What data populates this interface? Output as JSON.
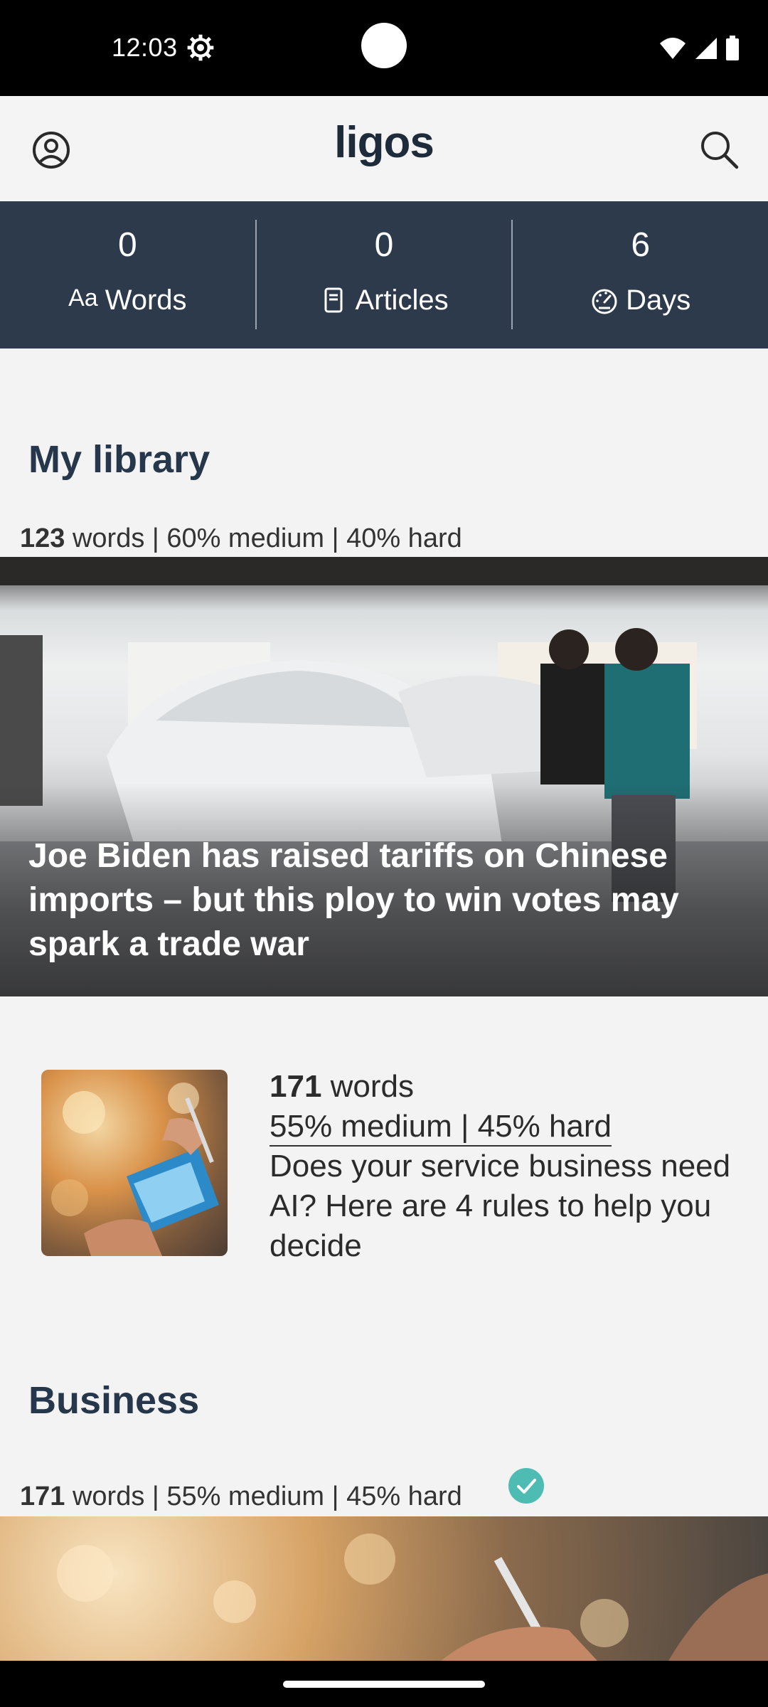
{
  "status_bar": {
    "time": "12:03"
  },
  "header": {
    "logo": "ligos"
  },
  "stats": [
    {
      "value": "0",
      "label": "Words",
      "icon": "font-size-icon"
    },
    {
      "value": "0",
      "label": "Articles",
      "icon": "document-icon"
    },
    {
      "value": "6",
      "label": "Days",
      "icon": "speedometer-icon"
    }
  ],
  "library": {
    "title": "My library",
    "featured": {
      "words": "123",
      "meta_rest": " words | 60% medium | 40% hard",
      "title": "Joe Biden has raised tariffs on Chinese imports – but this ploy to win votes may spark a trade war"
    },
    "item": {
      "words": "171",
      "words_suffix": " words",
      "difficulty": "55% medium | 45% hard",
      "title": "Does your service business need AI? Here are 4 rules to help you decide"
    }
  },
  "business": {
    "title": "Business",
    "words": "171",
    "meta_rest": " words | 55% medium | 45% hard",
    "completed_color": "#4fbcb4"
  }
}
